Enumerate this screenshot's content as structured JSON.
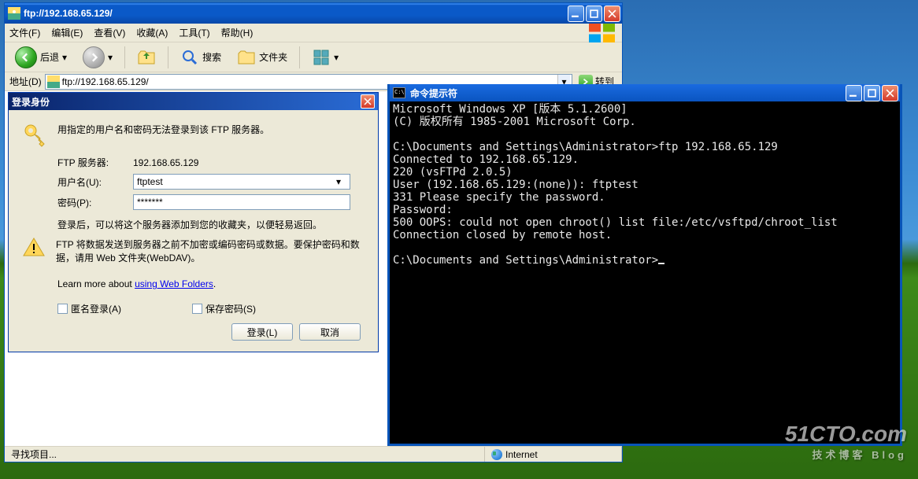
{
  "explorer": {
    "title": "ftp://192.168.65.129/",
    "menus": [
      "文件(F)",
      "编辑(E)",
      "查看(V)",
      "收藏(A)",
      "工具(T)",
      "帮助(H)"
    ],
    "toolbar": {
      "back": "后退",
      "search": "搜索",
      "folders": "文件夹"
    },
    "address_label": "地址(D)",
    "address_value": "ftp://192.168.65.129/",
    "go_label": "转到",
    "status_find": "寻找项目...",
    "status_zone": "Internet"
  },
  "dialog": {
    "title": "登录身份",
    "msg_main": "用指定的用户名和密码无法登录到该 FTP 服务器。",
    "server_label": "FTP 服务器:",
    "server_value": "192.168.65.129",
    "user_label": "用户名(U):",
    "user_value": "ftptest",
    "pass_label": "密码(P):",
    "pass_value": "*******",
    "msg_fav": "登录后，可以将这个服务器添加到您的收藏夹，以便轻易返回。",
    "msg_webdav": "FTP 将数据发送到服务器之前不加密或编码密码或数据。要保护密码和数据，请用 Web 文件夹(WebDAV)。",
    "learn_prefix": "Learn more about ",
    "learn_link": "using Web Folders",
    "learn_suffix": ".",
    "anon_label": "匿名登录(A)",
    "save_label": "保存密码(S)",
    "login_btn": "登录(L)",
    "cancel_btn": "取消"
  },
  "cmd": {
    "title": "命令提示符",
    "lines": [
      "Microsoft Windows XP [版本 5.1.2600]",
      "(C) 版权所有 1985-2001 Microsoft Corp.",
      "",
      "C:\\Documents and Settings\\Administrator>ftp 192.168.65.129",
      "Connected to 192.168.65.129.",
      "220 (vsFTPd 2.0.5)",
      "User (192.168.65.129:(none)): ftptest",
      "331 Please specify the password.",
      "Password:",
      "500 OOPS: could not open chroot() list file:/etc/vsftpd/chroot_list",
      "Connection closed by remote host.",
      "",
      "C:\\Documents and Settings\\Administrator>"
    ]
  },
  "watermark": {
    "main": "51CTO.com",
    "sub": "技术博客   Blog"
  }
}
